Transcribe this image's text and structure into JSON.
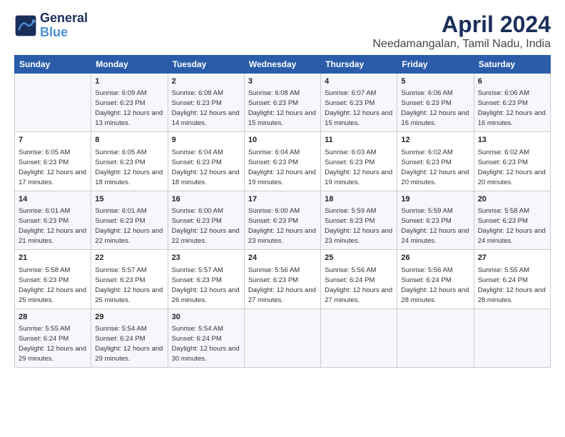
{
  "logo": {
    "line1": "General",
    "line2": "Blue"
  },
  "title": "April 2024",
  "subtitle": "Needamangalan, Tamil Nadu, India",
  "days_header": [
    "Sunday",
    "Monday",
    "Tuesday",
    "Wednesday",
    "Thursday",
    "Friday",
    "Saturday"
  ],
  "weeks": [
    [
      {
        "day": "",
        "sunrise": "",
        "sunset": "",
        "daylight": ""
      },
      {
        "day": "1",
        "sunrise": "Sunrise: 6:09 AM",
        "sunset": "Sunset: 6:23 PM",
        "daylight": "Daylight: 12 hours and 13 minutes."
      },
      {
        "day": "2",
        "sunrise": "Sunrise: 6:08 AM",
        "sunset": "Sunset: 6:23 PM",
        "daylight": "Daylight: 12 hours and 14 minutes."
      },
      {
        "day": "3",
        "sunrise": "Sunrise: 6:08 AM",
        "sunset": "Sunset: 6:23 PM",
        "daylight": "Daylight: 12 hours and 15 minutes."
      },
      {
        "day": "4",
        "sunrise": "Sunrise: 6:07 AM",
        "sunset": "Sunset: 6:23 PM",
        "daylight": "Daylight: 12 hours and 15 minutes."
      },
      {
        "day": "5",
        "sunrise": "Sunrise: 6:06 AM",
        "sunset": "Sunset: 6:23 PM",
        "daylight": "Daylight: 12 hours and 16 minutes."
      },
      {
        "day": "6",
        "sunrise": "Sunrise: 6:06 AM",
        "sunset": "Sunset: 6:23 PM",
        "daylight": "Daylight: 12 hours and 16 minutes."
      }
    ],
    [
      {
        "day": "7",
        "sunrise": "Sunrise: 6:05 AM",
        "sunset": "Sunset: 6:23 PM",
        "daylight": "Daylight: 12 hours and 17 minutes."
      },
      {
        "day": "8",
        "sunrise": "Sunrise: 6:05 AM",
        "sunset": "Sunset: 6:23 PM",
        "daylight": "Daylight: 12 hours and 18 minutes."
      },
      {
        "day": "9",
        "sunrise": "Sunrise: 6:04 AM",
        "sunset": "Sunset: 6:23 PM",
        "daylight": "Daylight: 12 hours and 18 minutes."
      },
      {
        "day": "10",
        "sunrise": "Sunrise: 6:04 AM",
        "sunset": "Sunset: 6:23 PM",
        "daylight": "Daylight: 12 hours and 19 minutes."
      },
      {
        "day": "11",
        "sunrise": "Sunrise: 6:03 AM",
        "sunset": "Sunset: 6:23 PM",
        "daylight": "Daylight: 12 hours and 19 minutes."
      },
      {
        "day": "12",
        "sunrise": "Sunrise: 6:02 AM",
        "sunset": "Sunset: 6:23 PM",
        "daylight": "Daylight: 12 hours and 20 minutes."
      },
      {
        "day": "13",
        "sunrise": "Sunrise: 6:02 AM",
        "sunset": "Sunset: 6:23 PM",
        "daylight": "Daylight: 12 hours and 20 minutes."
      }
    ],
    [
      {
        "day": "14",
        "sunrise": "Sunrise: 6:01 AM",
        "sunset": "Sunset: 6:23 PM",
        "daylight": "Daylight: 12 hours and 21 minutes."
      },
      {
        "day": "15",
        "sunrise": "Sunrise: 6:01 AM",
        "sunset": "Sunset: 6:23 PM",
        "daylight": "Daylight: 12 hours and 22 minutes."
      },
      {
        "day": "16",
        "sunrise": "Sunrise: 6:00 AM",
        "sunset": "Sunset: 6:23 PM",
        "daylight": "Daylight: 12 hours and 22 minutes."
      },
      {
        "day": "17",
        "sunrise": "Sunrise: 6:00 AM",
        "sunset": "Sunset: 6:23 PM",
        "daylight": "Daylight: 12 hours and 23 minutes."
      },
      {
        "day": "18",
        "sunrise": "Sunrise: 5:59 AM",
        "sunset": "Sunset: 6:23 PM",
        "daylight": "Daylight: 12 hours and 23 minutes."
      },
      {
        "day": "19",
        "sunrise": "Sunrise: 5:59 AM",
        "sunset": "Sunset: 6:23 PM",
        "daylight": "Daylight: 12 hours and 24 minutes."
      },
      {
        "day": "20",
        "sunrise": "Sunrise: 5:58 AM",
        "sunset": "Sunset: 6:23 PM",
        "daylight": "Daylight: 12 hours and 24 minutes."
      }
    ],
    [
      {
        "day": "21",
        "sunrise": "Sunrise: 5:58 AM",
        "sunset": "Sunset: 6:23 PM",
        "daylight": "Daylight: 12 hours and 25 minutes."
      },
      {
        "day": "22",
        "sunrise": "Sunrise: 5:57 AM",
        "sunset": "Sunset: 6:23 PM",
        "daylight": "Daylight: 12 hours and 25 minutes."
      },
      {
        "day": "23",
        "sunrise": "Sunrise: 5:57 AM",
        "sunset": "Sunset: 6:23 PM",
        "daylight": "Daylight: 12 hours and 26 minutes."
      },
      {
        "day": "24",
        "sunrise": "Sunrise: 5:56 AM",
        "sunset": "Sunset: 6:23 PM",
        "daylight": "Daylight: 12 hours and 27 minutes."
      },
      {
        "day": "25",
        "sunrise": "Sunrise: 5:56 AM",
        "sunset": "Sunset: 6:24 PM",
        "daylight": "Daylight: 12 hours and 27 minutes."
      },
      {
        "day": "26",
        "sunrise": "Sunrise: 5:56 AM",
        "sunset": "Sunset: 6:24 PM",
        "daylight": "Daylight: 12 hours and 28 minutes."
      },
      {
        "day": "27",
        "sunrise": "Sunrise: 5:55 AM",
        "sunset": "Sunset: 6:24 PM",
        "daylight": "Daylight: 12 hours and 28 minutes."
      }
    ],
    [
      {
        "day": "28",
        "sunrise": "Sunrise: 5:55 AM",
        "sunset": "Sunset: 6:24 PM",
        "daylight": "Daylight: 12 hours and 29 minutes."
      },
      {
        "day": "29",
        "sunrise": "Sunrise: 5:54 AM",
        "sunset": "Sunset: 6:24 PM",
        "daylight": "Daylight: 12 hours and 29 minutes."
      },
      {
        "day": "30",
        "sunrise": "Sunrise: 5:54 AM",
        "sunset": "Sunset: 6:24 PM",
        "daylight": "Daylight: 12 hours and 30 minutes."
      },
      {
        "day": "",
        "sunrise": "",
        "sunset": "",
        "daylight": ""
      },
      {
        "day": "",
        "sunrise": "",
        "sunset": "",
        "daylight": ""
      },
      {
        "day": "",
        "sunrise": "",
        "sunset": "",
        "daylight": ""
      },
      {
        "day": "",
        "sunrise": "",
        "sunset": "",
        "daylight": ""
      }
    ]
  ]
}
